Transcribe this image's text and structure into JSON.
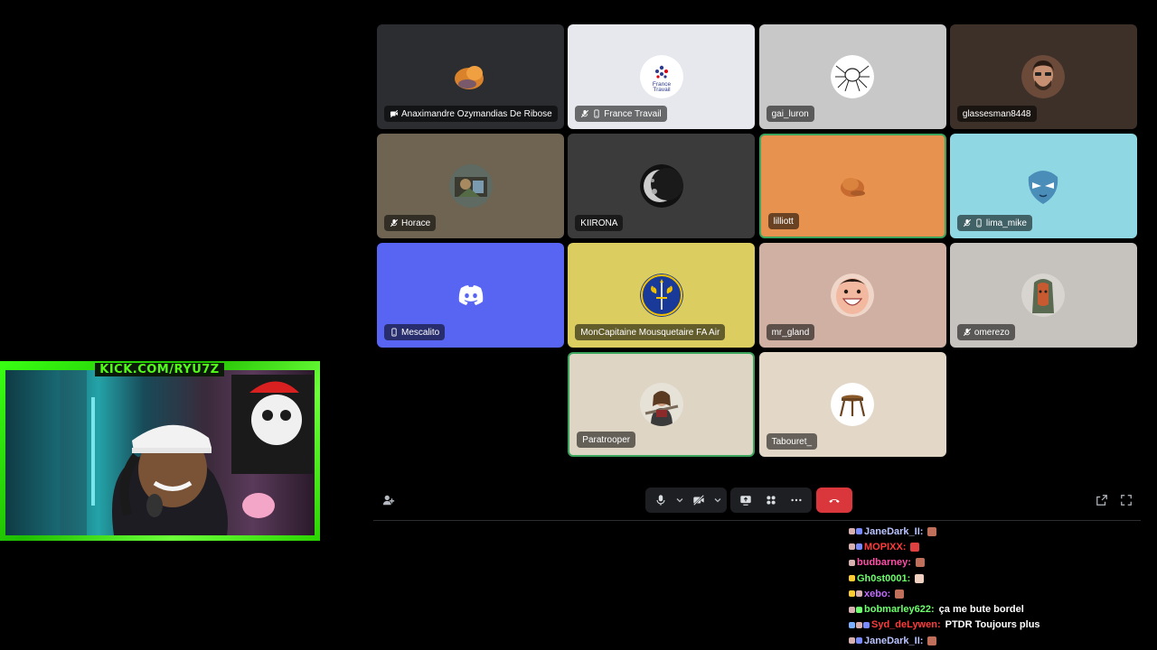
{
  "call": {
    "participants": [
      {
        "name": "Anaximandre Ozymandias De Ribose",
        "bg": "#2b2d31",
        "avatar": "orange-blob",
        "status": [
          "video-off-icon"
        ],
        "speaking": false
      },
      {
        "name": "France Travail",
        "bg": "#e6e8ee",
        "avatar": "france-travail-logo",
        "logo_text": [
          "France",
          "Travail"
        ],
        "status": [
          "mic-muted-icon",
          "mobile-icon"
        ],
        "speaking": false
      },
      {
        "name": "gai_luron",
        "bg": "#c8c8c8",
        "avatar": "spider-sketch",
        "status": [],
        "speaking": false
      },
      {
        "name": "glassesman8448",
        "bg": "#3d3029",
        "avatar": "man-portrait",
        "status": [],
        "speaking": false
      },
      {
        "name": "Horace",
        "bg": "#6f6452",
        "avatar": "photo-collage",
        "status": [
          "mic-muted-icon"
        ],
        "speaking": false
      },
      {
        "name": "KIIRONA",
        "bg": "#3b3b3b",
        "avatar": "moon",
        "status": [],
        "speaking": false
      },
      {
        "name": "lilliott",
        "bg": "#e8924f",
        "avatar": "bread-blob",
        "status": [],
        "speaking": true
      },
      {
        "name": "lima_mike",
        "bg": "#8fd8e3",
        "avatar": "blue-mask",
        "status": [
          "mic-muted-icon",
          "mobile-icon"
        ],
        "speaking": false
      },
      {
        "name": "Mescalito",
        "bg": "#5865f2",
        "avatar": "discord-logo",
        "status": [
          "mobile-icon"
        ],
        "speaking": false
      },
      {
        "name": "MonCapitaine Mousquetaire FA Air",
        "bg": "#dccd61",
        "avatar": "fleur-de-lis-shield",
        "status": [],
        "speaking": false
      },
      {
        "name": "mr_gland",
        "bg": "#cfb0a3",
        "avatar": "smiling-face",
        "status": [],
        "speaking": false
      },
      {
        "name": "omerezo",
        "bg": "#c6c3bf",
        "avatar": "creature",
        "status": [
          "mic-muted-icon"
        ],
        "speaking": false
      },
      {
        "name": "Paratrooper",
        "bg": "#ded5c4",
        "avatar": "warrior-portrait",
        "status": [],
        "speaking": true
      },
      {
        "name": "Tabouret_",
        "bg": "#e3d8c8",
        "avatar": "stool",
        "status": [],
        "speaking": false
      }
    ],
    "colors": {
      "hangup": "#da373c",
      "speaking": "#3ba55d",
      "controlbar": "#1e1f22"
    }
  },
  "webcam": {
    "banner": "KICK.COM/RYU7Z"
  },
  "chat": {
    "messages": [
      {
        "user": "JaneDark_II:",
        "color": "#b9c4ff",
        "text": "",
        "emote": "#c0705a",
        "badges": [
          "#d9b0b0",
          "#7a8aff"
        ]
      },
      {
        "user": "MOPIXX:",
        "color": "#ff3b3b",
        "text": "",
        "emote": "#e04040",
        "badges": [
          "#d9b0b0",
          "#7a8aff"
        ]
      },
      {
        "user": "budbarney:",
        "color": "#ff4fa8",
        "text": "",
        "emote": "#c0705a",
        "badges": [
          "#d9b0b0"
        ]
      },
      {
        "user": "Gh0st0001:",
        "color": "#6dff6d",
        "text": "",
        "emote": "#f0d0c0",
        "badges": [
          "#ffcc33"
        ]
      },
      {
        "user": "xebo:",
        "color": "#c46bff",
        "text": "",
        "emote": "#c0705a",
        "badges": [
          "#ffcc33",
          "#d9b0b0"
        ]
      },
      {
        "user": "bobmarley622:",
        "color": "#6dff6d",
        "text": "ça me bute bordel",
        "emote": "",
        "badges": [
          "#d9b0b0",
          "#6dff6d"
        ]
      },
      {
        "user": "Syd_deLywen:",
        "color": "#ff3b3b",
        "text": "PTDR Toujours plus",
        "emote": "",
        "badges": [
          "#7ab0ff",
          "#d9b0b0",
          "#7a8aff"
        ]
      },
      {
        "user": "JaneDark_II:",
        "color": "#b9c4ff",
        "text": "",
        "emote": "#c0705a",
        "badges": [
          "#d9b0b0",
          "#7a8aff"
        ]
      }
    ]
  }
}
